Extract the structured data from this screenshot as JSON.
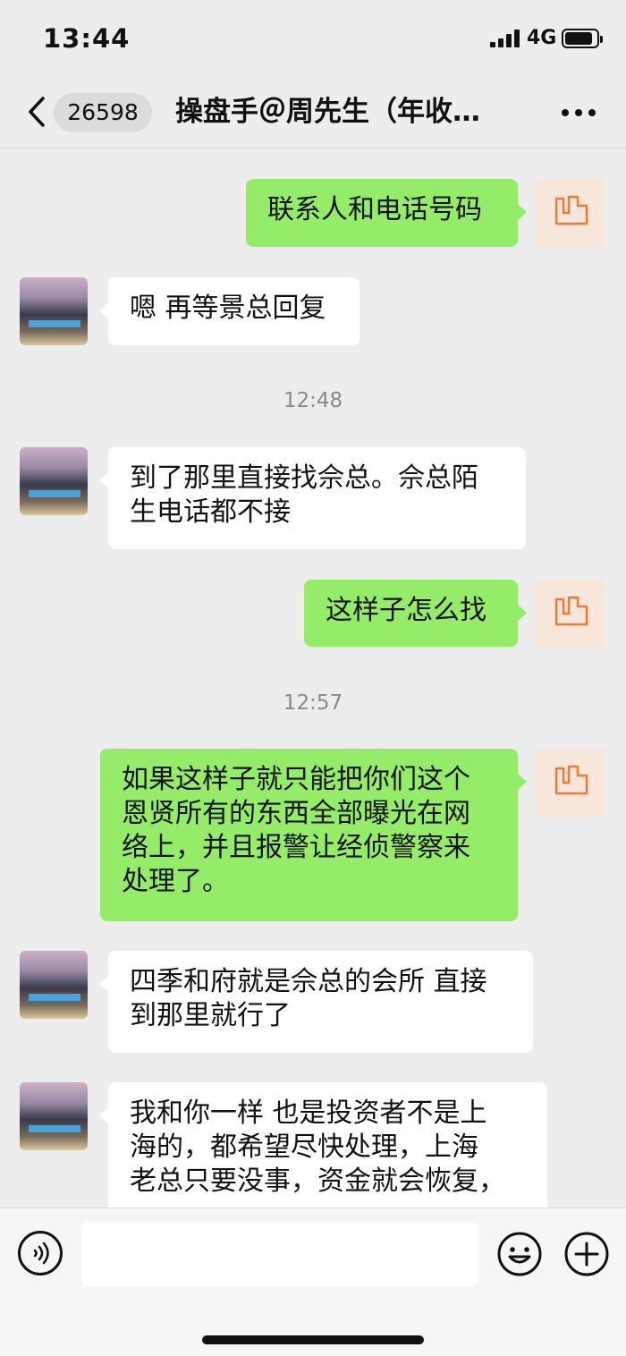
{
  "status_bar": {
    "time": "13:44",
    "network": "4G"
  },
  "header": {
    "back_icon": "chevron-left-icon",
    "unread_count": "26598",
    "title": "操盘手＠周先生（年收…",
    "more_icon": "more-dots-icon"
  },
  "messages": [
    {
      "sender": "self",
      "text": "联系人和电话号码"
    },
    {
      "sender": "other",
      "text": "嗯 再等景总回复"
    },
    {
      "type": "time",
      "text": "12:48"
    },
    {
      "sender": "other",
      "lines": [
        "到了那里直接找佘总。佘总陌",
        "生电话都不接"
      ]
    },
    {
      "sender": "self",
      "text": "这样子怎么找"
    },
    {
      "type": "time",
      "text": "12:57"
    },
    {
      "sender": "self",
      "lines": [
        "如果这样子就只能把你们这个",
        "恩贤所有的东西全部曝光在网",
        "络上，并且报警让经侦警察来",
        "处理了。"
      ]
    },
    {
      "sender": "other",
      "lines": [
        "四季和府就是佘总的会所 直接",
        "到那里就行了"
      ]
    },
    {
      "sender": "other",
      "lines": [
        "我和你一样 也是投资者不是上",
        "海的，都希望尽快处理，上海",
        "老总只要没事，资金就会恢复，"
      ]
    }
  ],
  "input_bar": {
    "voice_icon": "voice-icon",
    "emoji_icon": "emoji-icon",
    "plus_icon": "plus-circle-icon",
    "placeholder": ""
  },
  "colors": {
    "background": "#ededed",
    "self_bubble": "#95ec69",
    "other_bubble": "#ffffff",
    "timestamp_text": "#8a8a8a"
  }
}
